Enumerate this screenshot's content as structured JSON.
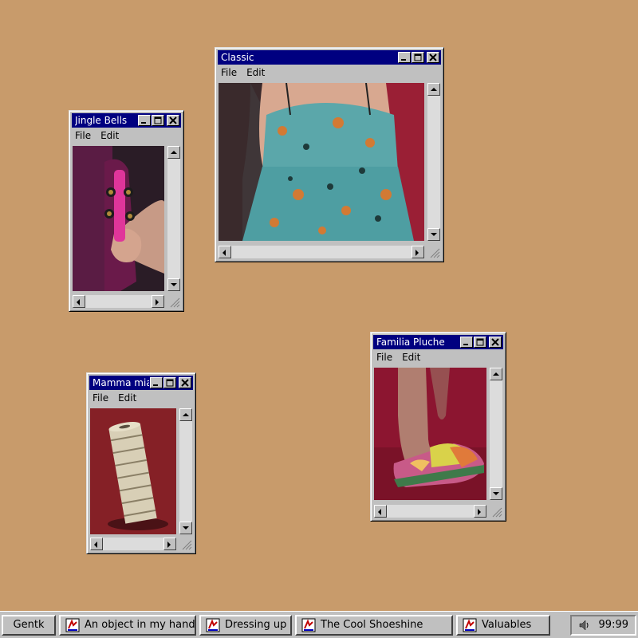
{
  "windows": {
    "classic": {
      "title": "Classic",
      "menu": [
        "File",
        "Edit"
      ]
    },
    "jingle": {
      "title": "Jingle Bells",
      "menu": [
        "File",
        "Edit"
      ]
    },
    "mamma": {
      "title": "Mamma mia!",
      "menu": [
        "File",
        "Edit"
      ]
    },
    "familia": {
      "title": "Familia Pluche",
      "menu": [
        "File",
        "Edit"
      ]
    }
  },
  "taskbar": {
    "start_label": "Gentk",
    "items": [
      "An object in my hand",
      "Dressing up",
      "The Cool Shoeshine",
      "Valuables"
    ],
    "clock": "99:99",
    "tray_icon": "speaker-icon"
  },
  "colors": {
    "desktop": "#c89b6b",
    "titlebar": "#000080",
    "chrome": "#c0c0c0"
  }
}
